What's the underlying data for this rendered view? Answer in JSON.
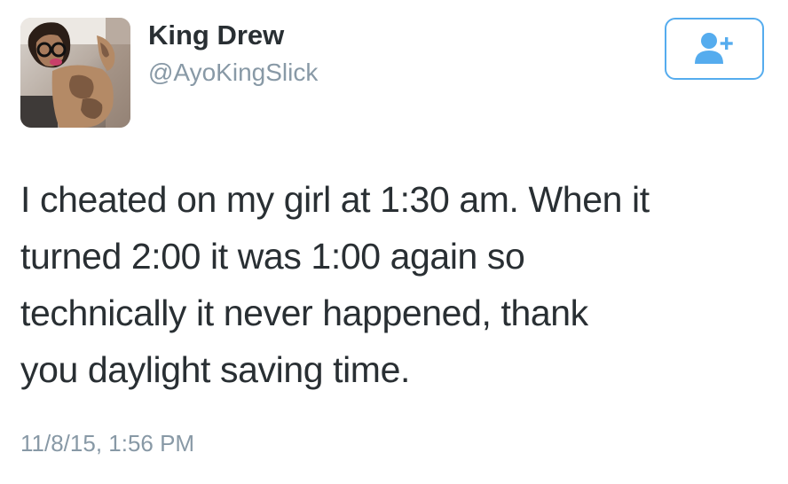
{
  "user": {
    "display_name": "King Drew",
    "handle": "@AyoKingSlick",
    "avatar_icon": "profile-photo"
  },
  "follow_button": {
    "icon": "follow-user-icon",
    "color": "#55acee"
  },
  "tweet": {
    "lines": [
      "I cheated on my girl at 1:30 am. When it",
      "turned 2:00 it was 1:00 again so",
      "technically it never happened, thank",
      "you daylight saving time."
    ],
    "timestamp": "11/8/15, 1:56 PM"
  },
  "colors": {
    "text": "#292f33",
    "secondary": "#8899a6",
    "accent": "#55acee"
  }
}
